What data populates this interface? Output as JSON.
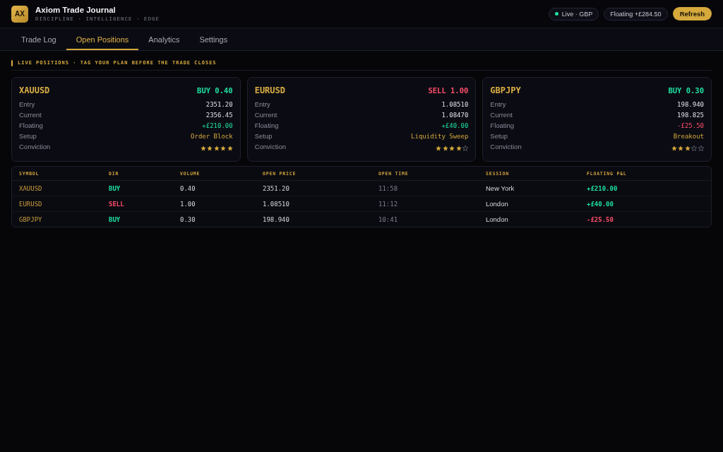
{
  "header": {
    "logo": "AX",
    "title": "Axiom Trade Journal",
    "tagline": "DISCIPLINE · INTELLIGENCE · EDGE",
    "status": {
      "label": "Live · GBP",
      "live": true
    },
    "floating_total": "Floating +£284.50",
    "refresh_button": "Refresh"
  },
  "tabs": [
    {
      "label": "Trade Log",
      "selected": false
    },
    {
      "label": "Open Positions",
      "selected": true
    },
    {
      "label": "Analytics",
      "selected": false
    },
    {
      "label": "Settings",
      "selected": false
    }
  ],
  "section_title": "LIVE POSITIONS · TAG YOUR PLAN BEFORE THE TRADE CLOSES",
  "position_cards": [
    {
      "symbol": "XAUUSD",
      "direction": {
        "text": "BUY 0.40",
        "kind": "buy"
      },
      "fields": [
        {
          "label": "Entry",
          "value": "2351.20",
          "kind": "price"
        },
        {
          "label": "Current",
          "value": "2356.45",
          "kind": "price"
        },
        {
          "label": "Floating",
          "value": "+£210.00",
          "kind": "gain"
        },
        {
          "label": "Setup",
          "value": "Order Block",
          "kind": "setup"
        }
      ],
      "conviction": {
        "label": "Conviction",
        "stars": 5
      }
    },
    {
      "symbol": "EURUSD",
      "direction": {
        "text": "SELL 1.00",
        "kind": "sell"
      },
      "fields": [
        {
          "label": "Entry",
          "value": "1.08510",
          "kind": "price"
        },
        {
          "label": "Current",
          "value": "1.08470",
          "kind": "price"
        },
        {
          "label": "Floating",
          "value": "+£40.00",
          "kind": "gain"
        },
        {
          "label": "Setup",
          "value": "Liquidity Sweep",
          "kind": "setup"
        }
      ],
      "conviction": {
        "label": "Conviction",
        "stars": 4
      }
    },
    {
      "symbol": "GBPJPY",
      "direction": {
        "text": "BUY 0.30",
        "kind": "buy"
      },
      "fields": [
        {
          "label": "Entry",
          "value": "198.940",
          "kind": "price"
        },
        {
          "label": "Current",
          "value": "198.825",
          "kind": "price"
        },
        {
          "label": "Floating",
          "value": "-£25.50",
          "kind": "loss"
        },
        {
          "label": "Setup",
          "value": "Breakout",
          "kind": "setup"
        }
      ],
      "conviction": {
        "label": "Conviction",
        "stars": 3
      }
    }
  ],
  "table": {
    "columns": [
      "SYMBOL",
      "DIR",
      "VOLUME",
      "OPEN PRICE",
      "OPEN TIME",
      "SESSION",
      "FLOATING P&L"
    ],
    "rows": [
      {
        "symbol": "XAUUSD",
        "dir": {
          "text": "BUY",
          "kind": "buy"
        },
        "volume": "0.40",
        "open_price": "2351.20",
        "open_time": "11:58",
        "session": "New York",
        "floating_pnl": {
          "text": "+£210.00",
          "kind": "gain"
        }
      },
      {
        "symbol": "EURUSD",
        "dir": {
          "text": "SELL",
          "kind": "sell"
        },
        "volume": "1.00",
        "open_price": "1.08510",
        "open_time": "11:12",
        "session": "London",
        "floating_pnl": {
          "text": "+£40.00",
          "kind": "gain"
        }
      },
      {
        "symbol": "GBPJPY",
        "dir": {
          "text": "BUY",
          "kind": "buy"
        },
        "volume": "0.30",
        "open_price": "198.940",
        "open_time": "10:41",
        "session": "London",
        "floating_pnl": {
          "text": "-£25.50",
          "kind": "loss"
        }
      }
    ]
  }
}
